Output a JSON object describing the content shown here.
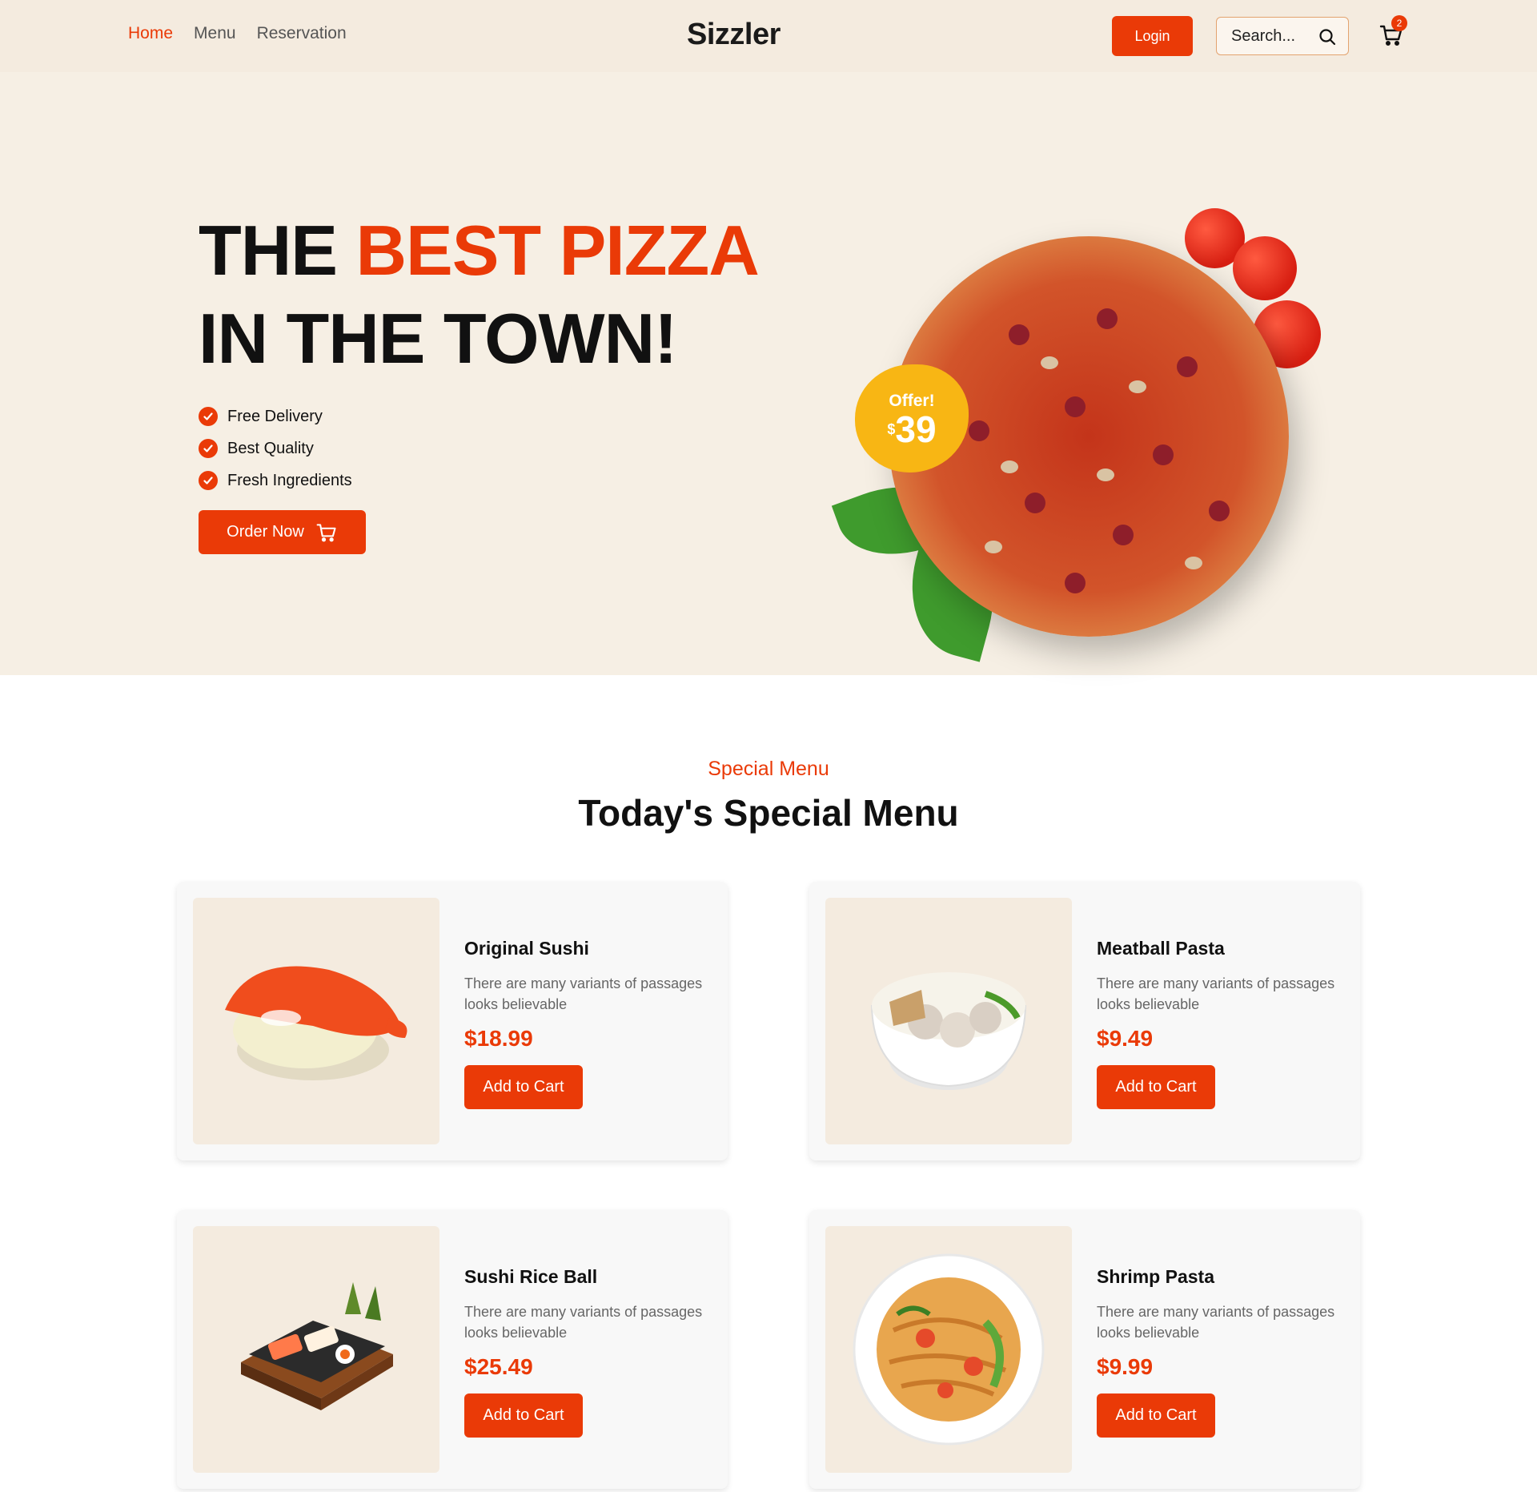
{
  "header": {
    "nav": [
      {
        "label": "Home"
      },
      {
        "label": "Menu"
      },
      {
        "label": "Reservation"
      }
    ],
    "brand": "Sizzler",
    "login_label": "Login",
    "search_placeholder": "Search...",
    "cart_count": "2"
  },
  "hero": {
    "title_line1_plain": "THE ",
    "title_line1_accent": "BEST PIZZA",
    "title_line2": "IN THE TOWN!",
    "features": [
      "Free Delivery",
      "Best Quality",
      "Fresh Ingredients"
    ],
    "order_label": "Order Now",
    "offer_label": "Offer!",
    "offer_currency": "$",
    "offer_amount": "39"
  },
  "special": {
    "subtitle": "Special Menu",
    "title": "Today's Special Menu",
    "items": [
      {
        "name": "Original Sushi",
        "desc": "There are many variants of passages looks believable",
        "price": "$18.99",
        "button": "Add to Cart"
      },
      {
        "name": "Meatball Pasta",
        "desc": "There are many variants of passages looks believable",
        "price": "$9.49",
        "button": "Add to Cart"
      },
      {
        "name": "Sushi Rice Ball",
        "desc": "There are many variants of passages looks believable",
        "price": "$25.49",
        "button": "Add to Cart"
      },
      {
        "name": "Shrimp Pasta",
        "desc": "There are many variants of passages looks believable",
        "price": "$9.99",
        "button": "Add to Cart"
      }
    ]
  },
  "colors": {
    "accent": "#ea3a07",
    "header_bg": "#f4ebdf",
    "hero_bg": "#f6efe4",
    "offer_badge": "#f8b614"
  }
}
